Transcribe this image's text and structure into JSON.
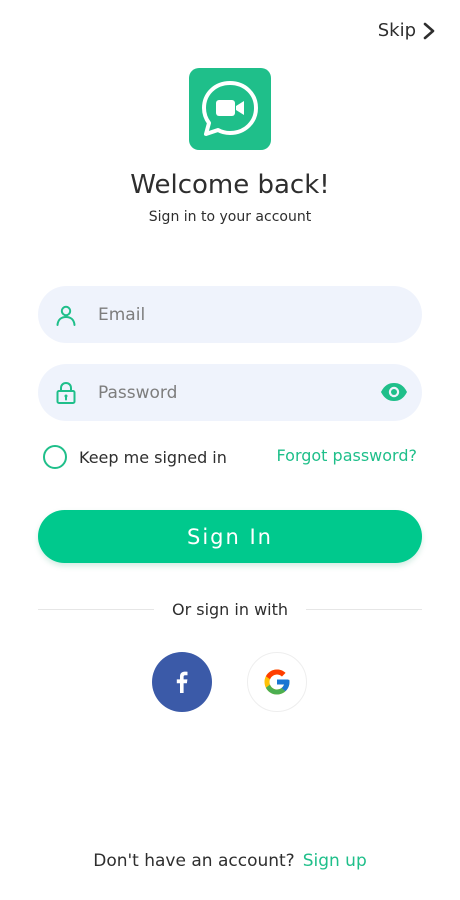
{
  "header": {
    "skip_label": "Skip"
  },
  "brand": {
    "color": "#1fbf8a",
    "logo_icon": "video-chat-icon"
  },
  "heading": {
    "title": "Welcome back!",
    "subtitle": "Sign in to your account"
  },
  "form": {
    "email": {
      "placeholder": "Email",
      "value": "",
      "icon": "user-icon"
    },
    "password": {
      "placeholder": "Password",
      "value": "",
      "icon": "lock-icon",
      "toggle_icon": "eye-icon"
    },
    "remember_label": "Keep me signed in",
    "remember_checked": false,
    "forgot_label": "Forgot password?",
    "submit_label": "Sign In",
    "submit_color": "#00c98d"
  },
  "social": {
    "divider_label": "Or sign in with",
    "providers": [
      {
        "name": "facebook",
        "icon": "facebook-icon",
        "color": "#3b5aa8"
      },
      {
        "name": "google",
        "icon": "google-icon",
        "color": "#ffffff"
      }
    ]
  },
  "footer": {
    "question": "Don't have an account?",
    "signup_label": "Sign up"
  }
}
